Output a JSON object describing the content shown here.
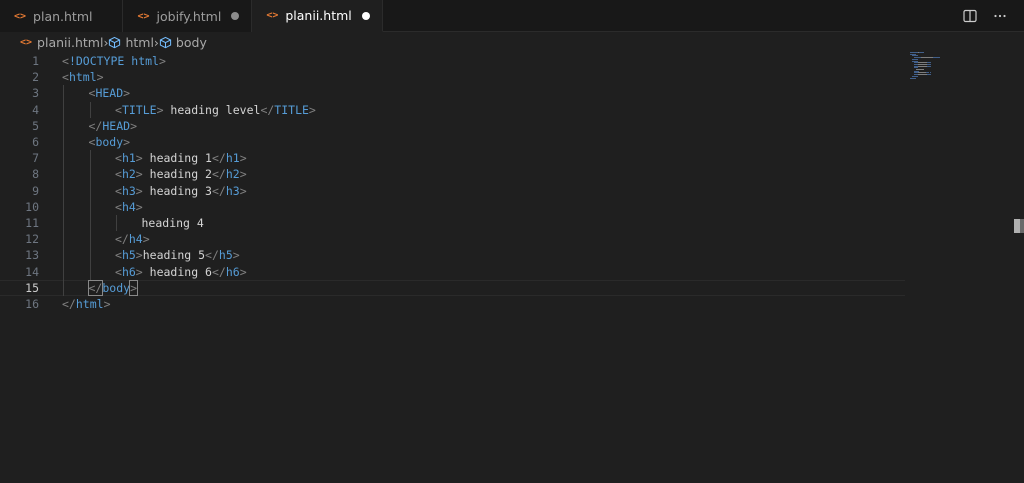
{
  "tabs": [
    {
      "label": "plan.html",
      "icon": "html-file-icon",
      "dirty": false,
      "active": false
    },
    {
      "label": "jobify.html",
      "icon": "html-file-icon",
      "dirty": true,
      "active": false
    },
    {
      "label": "planii.html",
      "icon": "html-file-icon",
      "dirty": true,
      "active": true
    }
  ],
  "tab_icon_glyph": "<>",
  "breadcrumb": {
    "file": "planii.html",
    "items": [
      "html",
      "body"
    ]
  },
  "editor": {
    "current_line": 15,
    "line_numbers": [
      "1",
      "2",
      "3",
      "4",
      "5",
      "6",
      "7",
      "8",
      "9",
      "10",
      "11",
      "12",
      "13",
      "14",
      "15",
      "16"
    ],
    "lines": [
      {
        "indent": 0,
        "parts": [
          [
            "b",
            "<"
          ],
          [
            "t",
            "!DOCTYPE"
          ],
          [
            "x",
            " "
          ],
          [
            "t",
            "html"
          ],
          [
            "b",
            ">"
          ]
        ]
      },
      {
        "indent": 0,
        "parts": [
          [
            "b",
            "<"
          ],
          [
            "t",
            "html"
          ],
          [
            "b",
            ">"
          ]
        ]
      },
      {
        "indent": 1,
        "parts": [
          [
            "b",
            "<"
          ],
          [
            "t",
            "HEAD"
          ],
          [
            "b",
            ">"
          ]
        ]
      },
      {
        "indent": 2,
        "parts": [
          [
            "b",
            "<"
          ],
          [
            "t",
            "TITLE"
          ],
          [
            "b",
            ">"
          ],
          [
            "x",
            " heading level"
          ],
          [
            "b",
            "</"
          ],
          [
            "t",
            "TITLE"
          ],
          [
            "b",
            ">"
          ]
        ]
      },
      {
        "indent": 1,
        "parts": [
          [
            "b",
            "</"
          ],
          [
            "t",
            "HEAD"
          ],
          [
            "b",
            ">"
          ]
        ]
      },
      {
        "indent": 1,
        "parts": [
          [
            "b",
            "<"
          ],
          [
            "t",
            "body"
          ],
          [
            "b",
            ">"
          ]
        ]
      },
      {
        "indent": 2,
        "parts": [
          [
            "b",
            "<"
          ],
          [
            "t",
            "h1"
          ],
          [
            "b",
            ">"
          ],
          [
            "x",
            " heading 1"
          ],
          [
            "b",
            "</"
          ],
          [
            "t",
            "h1"
          ],
          [
            "b",
            ">"
          ]
        ]
      },
      {
        "indent": 2,
        "parts": [
          [
            "b",
            "<"
          ],
          [
            "t",
            "h2"
          ],
          [
            "b",
            ">"
          ],
          [
            "x",
            " heading 2"
          ],
          [
            "b",
            "</"
          ],
          [
            "t",
            "h2"
          ],
          [
            "b",
            ">"
          ]
        ]
      },
      {
        "indent": 2,
        "parts": [
          [
            "b",
            "<"
          ],
          [
            "t",
            "h3"
          ],
          [
            "b",
            ">"
          ],
          [
            "x",
            " heading 3"
          ],
          [
            "b",
            "</"
          ],
          [
            "t",
            "h3"
          ],
          [
            "b",
            ">"
          ]
        ]
      },
      {
        "indent": 2,
        "parts": [
          [
            "b",
            "<"
          ],
          [
            "t",
            "h4"
          ],
          [
            "b",
            ">"
          ]
        ]
      },
      {
        "indent": 3,
        "parts": [
          [
            "x",
            "heading 4"
          ]
        ]
      },
      {
        "indent": 2,
        "parts": [
          [
            "b",
            "</"
          ],
          [
            "t",
            "h4"
          ],
          [
            "b",
            ">"
          ]
        ]
      },
      {
        "indent": 2,
        "parts": [
          [
            "b",
            "<"
          ],
          [
            "t",
            "h5"
          ],
          [
            "b",
            ">"
          ],
          [
            "x",
            "heading 5"
          ],
          [
            "b",
            "</"
          ],
          [
            "t",
            "h5"
          ],
          [
            "b",
            ">"
          ]
        ]
      },
      {
        "indent": 2,
        "parts": [
          [
            "b",
            "<"
          ],
          [
            "t",
            "h6"
          ],
          [
            "b",
            ">"
          ],
          [
            "x",
            " heading 6"
          ],
          [
            "b",
            "</"
          ],
          [
            "t",
            "h6"
          ],
          [
            "b",
            ">"
          ]
        ]
      },
      {
        "indent": 1,
        "parts": [
          [
            "b",
            "</"
          ],
          [
            "t",
            "body"
          ],
          [
            "b",
            ">"
          ]
        ]
      },
      {
        "indent": 0,
        "parts": [
          [
            "b",
            "</"
          ],
          [
            "t",
            "html"
          ],
          [
            "b",
            ">"
          ]
        ]
      }
    ]
  },
  "colors": {
    "tag": "#569cd6",
    "bracket": "#808080",
    "text": "#d4d4d4",
    "line_number": "#6e7681",
    "file_icon": "#e37933",
    "background": "#1f1f1f"
  },
  "actions": [
    "split-editor-icon",
    "more-actions-icon"
  ]
}
